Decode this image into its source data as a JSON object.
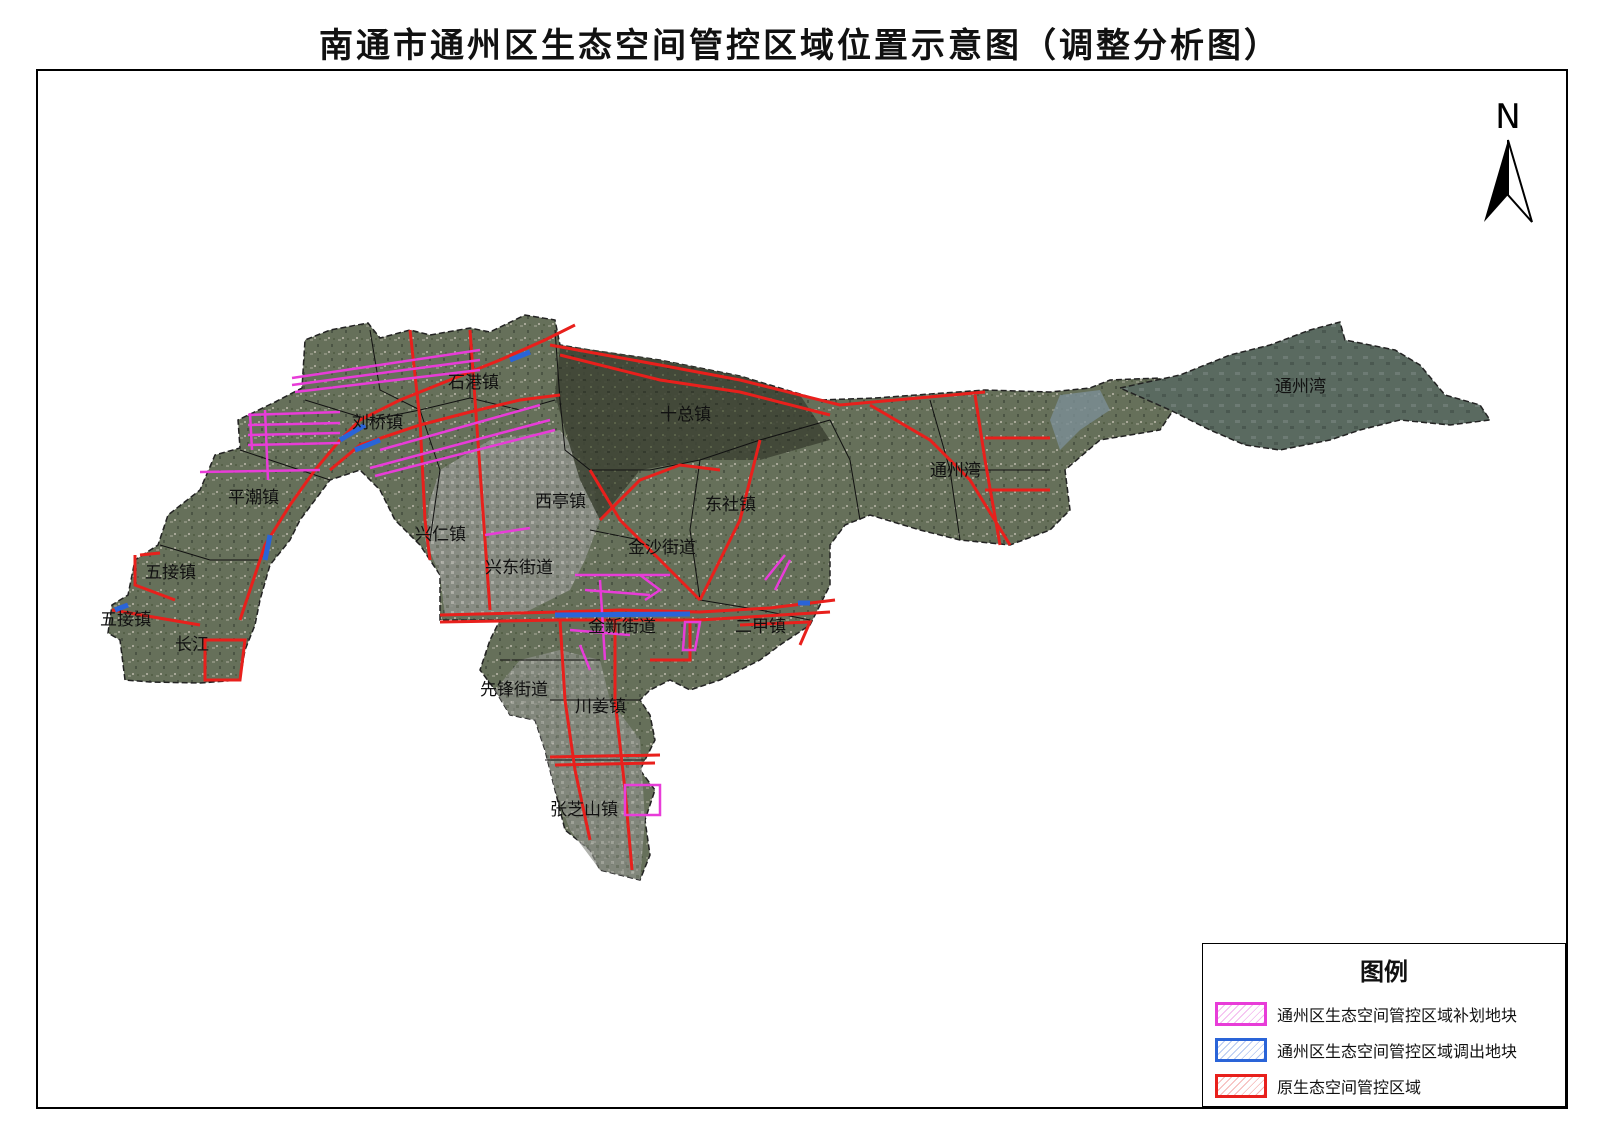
{
  "title": "南通市通州区生态空间管控区域位置示意图（调整分析图）",
  "north_arrow": {
    "letter": "N"
  },
  "places": {
    "shigang": "石港镇",
    "liuqiao": "刘桥镇",
    "pingchao": "平潮镇",
    "wujie": "五接镇",
    "wujie_edge": "五接镇",
    "changjiang": "长江",
    "shizong": "十总镇",
    "xiting": "西亭镇",
    "xingren": "兴仁镇",
    "xingdong": "兴东街道",
    "jinsha": "金沙街道",
    "dongshe": "东社镇",
    "jinxin": "金新街道",
    "jiazhen": "二甲镇",
    "xianfeng": "先锋街道",
    "chuanjiang": "川姜镇",
    "zhangzhishan": "张芝山镇",
    "tongzhouwan_land": "通州湾",
    "tongzhouwan_sea": "通州湾"
  },
  "legend": {
    "title": "图例",
    "items": [
      {
        "label": "通州区生态空间管控区域补划地块",
        "color": "#e83cd8"
      },
      {
        "label": "通州区生态空间管控区域调出地块",
        "color": "#2a64d8"
      },
      {
        "label": "原生态空间管控区域",
        "color": "#e8201c"
      }
    ]
  },
  "colors": {
    "land": "#5f6a52",
    "coast": "#2a2a2a",
    "added": "#e83cd8",
    "removed": "#2a64d8",
    "original": "#e8201c"
  }
}
